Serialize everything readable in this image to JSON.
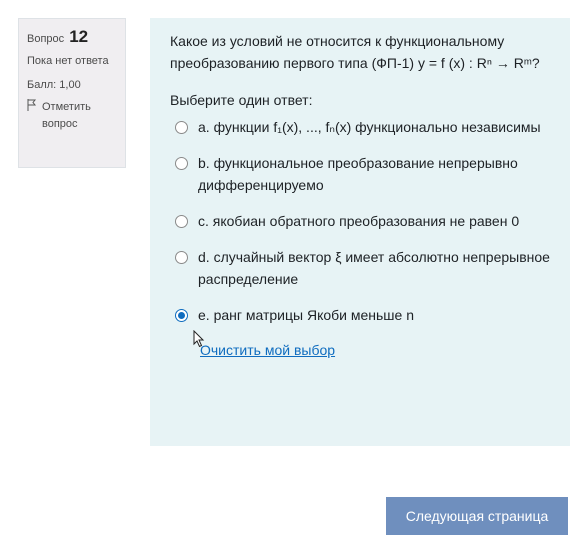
{
  "info": {
    "question_label": "Вопрос",
    "question_number": "12",
    "state": "Пока нет ответа",
    "grade": "Балл: 1,00",
    "flag_label": "Отметить вопрос"
  },
  "question": {
    "text": "Какое из условий не относится к функциональному преобразованию первого типа (ФП-1) y = f (x) : Rⁿ → Rᵐ?",
    "prompt": "Выберите один ответ:",
    "answers": [
      {
        "label": "a. функции f₁(x), ..., fₙ(x) функционально независимы",
        "checked": false
      },
      {
        "label": "b. функциональное преобразование непрерывно дифференцируемо",
        "checked": false
      },
      {
        "label": "c. якобиан обратного преобразования не равен 0",
        "checked": false
      },
      {
        "label": "d. случайный вектор ξ имеет абсолютно непрерывное распределение",
        "checked": false
      },
      {
        "label": "e. ранг матрицы Якоби меньше n",
        "checked": true
      }
    ],
    "clear_label": "Очистить мой выбор"
  },
  "navigation": {
    "next_label": "Следующая страница"
  },
  "colors": {
    "accent": "#0f6cbf",
    "content_bg": "#e7f3f5",
    "info_bg": "#f0eef1",
    "next_button_bg": "#6f8fbe"
  }
}
